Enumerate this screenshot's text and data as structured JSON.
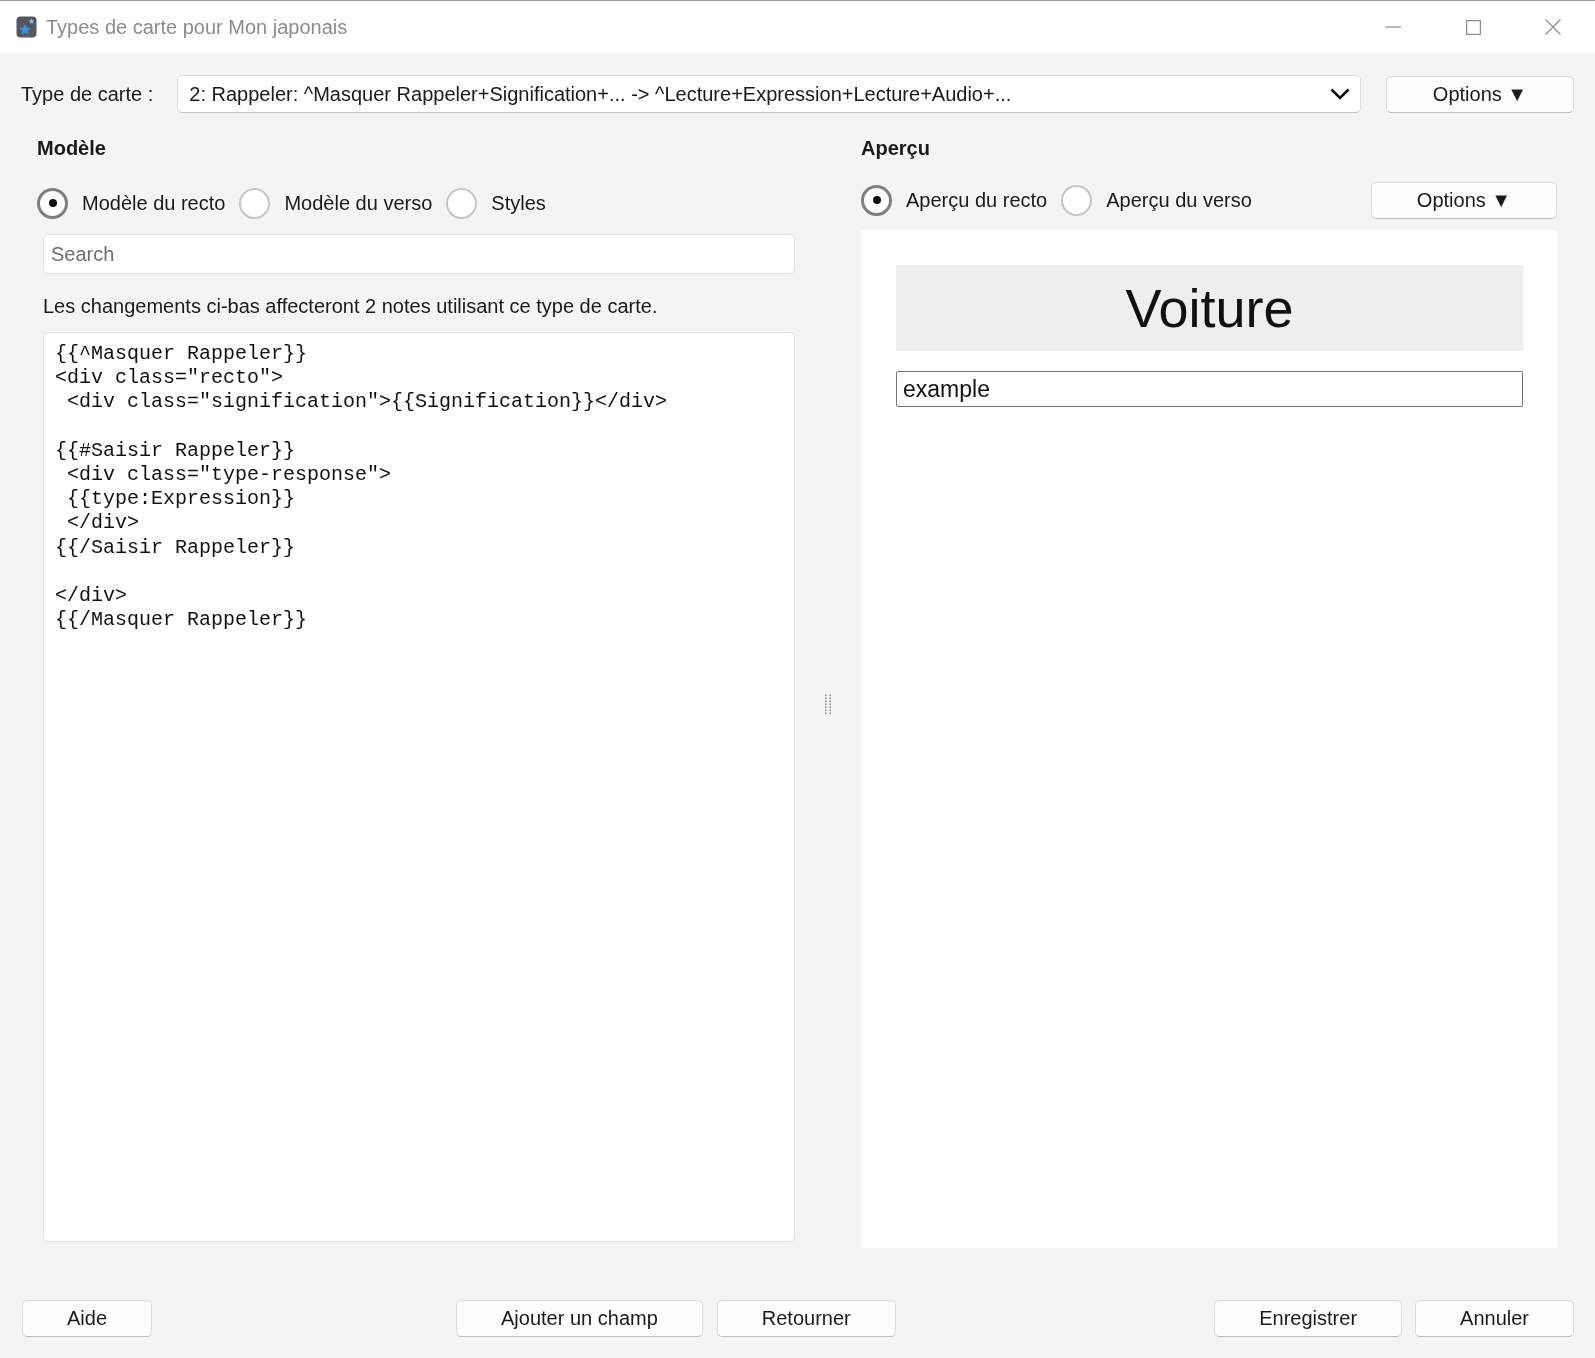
{
  "window": {
    "title": "Types de carte pour Mon japonais"
  },
  "card_type": {
    "label": "Type de carte :",
    "value": "2: Rappeler: ^Masquer Rappeler+Signification+... -> ^Lecture+Expression+Lecture+Audio+...",
    "options_button": "Options ▼"
  },
  "template": {
    "heading": "Modèle",
    "tabs": [
      {
        "label": "Modèle du recto",
        "selected": true
      },
      {
        "label": "Modèle du verso",
        "selected": false
      },
      {
        "label": "Styles",
        "selected": false
      }
    ],
    "search": {
      "placeholder": "Search"
    },
    "notice": "Les changements ci-bas affecteront 2 notes utilisant ce type de carte.",
    "code": "{{^Masquer Rappeler}}\n<div class=\"recto\">\n <div class=\"signification\">{{Signification}}</div>\n\n{{#Saisir Rappeler}}\n <div class=\"type-response\">\n {{type:Expression}}\n </div>\n{{/Saisir Rappeler}}\n\n</div>\n{{/Masquer Rappeler}}"
  },
  "preview": {
    "heading": "Aperçu",
    "tabs": [
      {
        "label": "Aperçu du recto",
        "selected": true
      },
      {
        "label": "Aperçu du verso",
        "selected": false
      }
    ],
    "options_button": "Options ▼",
    "question": "Voiture",
    "answer_field": {
      "value": "example"
    }
  },
  "footer": {
    "left": [
      "Aide"
    ],
    "middle": [
      "Ajouter un champ",
      "Retourner"
    ],
    "right": [
      "Enregistrer",
      "Annuler"
    ]
  }
}
